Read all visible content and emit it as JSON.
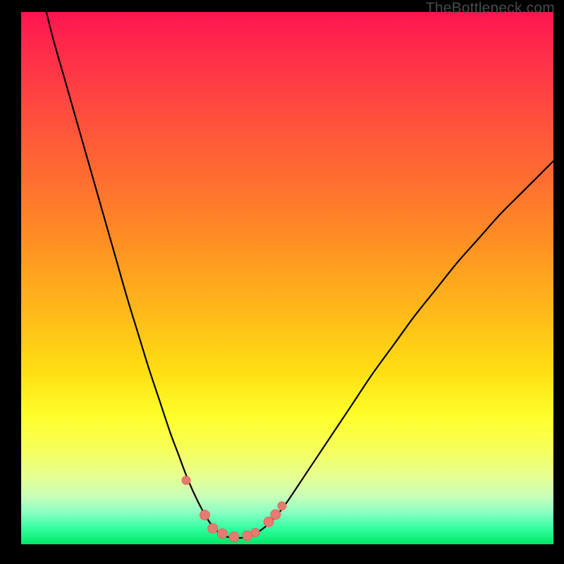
{
  "attribution": "TheBottleneck.com",
  "colors": {
    "frame": "#000000",
    "curve": "#000000",
    "markers_fill": "#e87a72",
    "markers_stroke": "#d66058"
  },
  "chart_data": {
    "type": "line",
    "title": "",
    "xlabel": "",
    "ylabel": "",
    "xlim": [
      0,
      100
    ],
    "ylim": [
      0,
      100
    ],
    "grid": false,
    "legend": false,
    "series": [
      {
        "name": "bottleneck-curve",
        "x": [
          4,
          6,
          8,
          10,
          12,
          14,
          16,
          18,
          20,
          22,
          24,
          26,
          28,
          29.5,
          31,
          32.5,
          34,
          35.5,
          37,
          38,
          40,
          42,
          44,
          46,
          48,
          50,
          54,
          58,
          62,
          66,
          70,
          74,
          78,
          82,
          86,
          90,
          94,
          98,
          100
        ],
        "y": [
          103,
          95,
          88,
          81,
          74,
          67,
          60,
          53,
          46,
          39.5,
          33,
          27,
          21,
          17,
          13,
          9.5,
          6.5,
          4,
          2.3,
          1.6,
          1.2,
          1.3,
          2.0,
          3.4,
          5.4,
          8.0,
          14,
          20,
          26,
          32,
          37.5,
          43,
          48,
          53,
          57.5,
          62,
          66,
          70,
          72
        ]
      }
    ],
    "markers": [
      {
        "x": 31.0,
        "y": 12.0,
        "r": 6
      },
      {
        "x": 34.5,
        "y": 5.5,
        "r": 7
      },
      {
        "x": 36.0,
        "y": 3.0,
        "r": 7
      },
      {
        "x": 37.8,
        "y": 2.0,
        "r": 7
      },
      {
        "x": 40.0,
        "y": 1.4,
        "r": 7
      },
      {
        "x": 42.5,
        "y": 1.6,
        "r": 7
      },
      {
        "x": 44.0,
        "y": 2.2,
        "r": 6
      },
      {
        "x": 46.5,
        "y": 4.2,
        "r": 7
      },
      {
        "x": 47.8,
        "y": 5.6,
        "r": 7
      },
      {
        "x": 49.0,
        "y": 7.2,
        "r": 6
      }
    ]
  }
}
